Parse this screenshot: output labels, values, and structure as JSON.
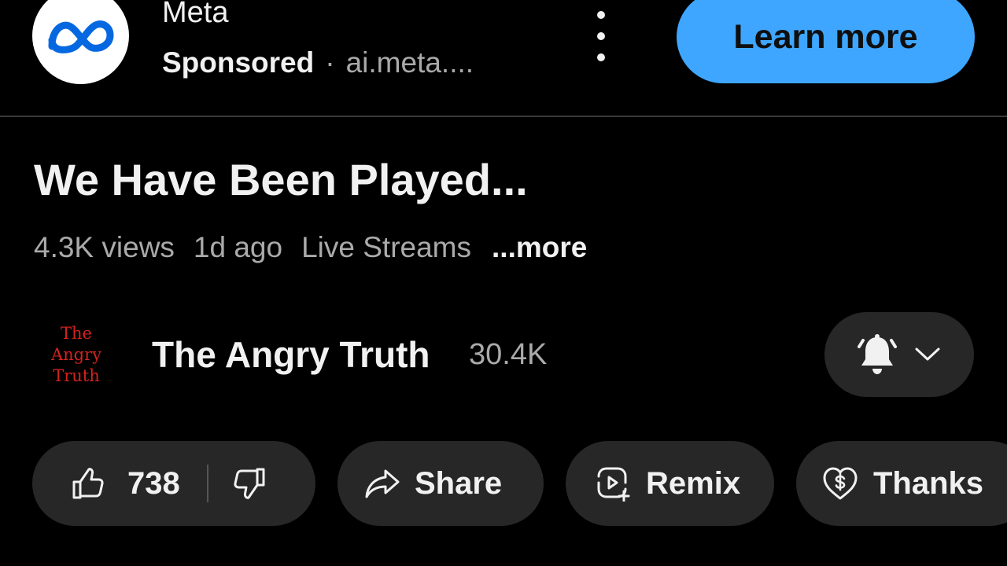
{
  "ad": {
    "advertiser": "Meta",
    "sponsored_label": "Sponsored",
    "separator": "·",
    "url": "ai.meta....",
    "cta_label": "Learn more",
    "logo_icon": "meta-infinity-logo",
    "menu_icon": "more-vertical-icon"
  },
  "video": {
    "title": "We Have Been Played...",
    "views": "4.3K views",
    "age": "1d ago",
    "category": "Live Streams",
    "more_label": "...more"
  },
  "channel": {
    "avatar_lines": [
      "The",
      "Angry",
      "Truth"
    ],
    "name": "The Angry Truth",
    "subscribers": "30.4K",
    "bell_icon": "notification-bell-icon",
    "chevron_icon": "chevron-down-icon"
  },
  "actions": {
    "like_count": "738",
    "share_label": "Share",
    "remix_label": "Remix",
    "thanks_label": "Thanks"
  },
  "colors": {
    "background": "#000000",
    "cta_blue": "#3ea6ff",
    "pill_bg": "#272727",
    "secondary_text": "#aaaaaa",
    "primary_text": "#f1f1f1",
    "avatar_red": "#d3231f",
    "meta_blue": "#0668e1"
  }
}
